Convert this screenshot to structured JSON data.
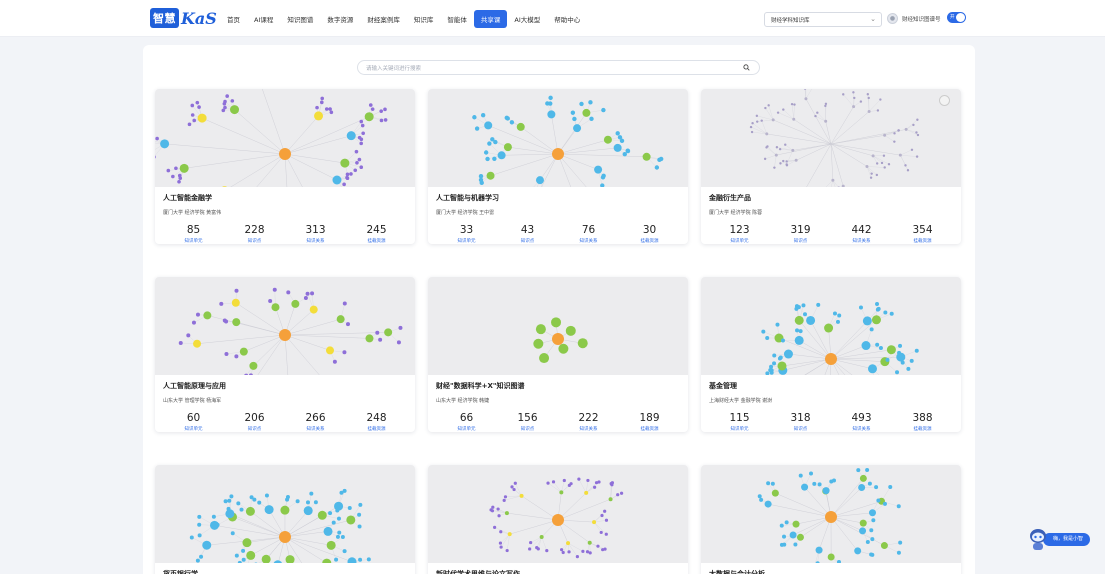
{
  "header": {
    "logo_badge": "智慧",
    "logo_text": "KaS",
    "nav": [
      "首页",
      "AI课程",
      "知识图谱",
      "数字资源",
      "财经案例库",
      "知识库",
      "智能体",
      "共享课",
      "AI大模型",
      "帮助中心"
    ],
    "active_nav": "共享课",
    "kb_select": "财经学科知识库",
    "user_name": "财经知识图谱号",
    "toggle_label": "开"
  },
  "search": {
    "placeholder": "请输入关键词进行搜索"
  },
  "stat_labels": [
    "知识单元",
    "知识点",
    "知识关系",
    "挂载资源"
  ],
  "cards": [
    {
      "title": "人工智能金融学",
      "authors": "厦门大学 经济学院 黄富伟",
      "stats": [
        "85",
        "228",
        "313",
        "245"
      ]
    },
    {
      "title": "人工智能与机器学习",
      "authors": "厦门大学 经济学院 王中雷",
      "stats": [
        "33",
        "43",
        "76",
        "30"
      ]
    },
    {
      "title": "金融衍生产品",
      "authors": "厦门大学 经济学院 陈蓉",
      "stats": [
        "123",
        "319",
        "442",
        "354"
      ]
    },
    {
      "title": "人工智能原理与应用",
      "authors": "山东大学 管理学院 杨海军",
      "stats": [
        "60",
        "206",
        "266",
        "248"
      ]
    },
    {
      "title": "财经\"数据科学+X\"知识图谱",
      "authors": "山东大学 经济学院 韩婕",
      "stats": [
        "66",
        "156",
        "222",
        "189"
      ]
    },
    {
      "title": "基金管理",
      "authors": "上海财经大学 金融学院 谢澍",
      "stats": [
        "115",
        "318",
        "493",
        "388"
      ]
    },
    {
      "title": "货币银行学",
      "authors": "",
      "stats": [
        "",
        "",
        "",
        ""
      ]
    },
    {
      "title": "新时代学术思维与论文写作",
      "authors": "",
      "stats": [
        "",
        "",
        "",
        ""
      ]
    },
    {
      "title": "大数据与会计分析",
      "authors": "",
      "stats": [
        "",
        "",
        "",
        ""
      ]
    }
  ],
  "assistant": {
    "label": "嗨，我是小智"
  },
  "colors": {
    "accent": "#2c6ae6",
    "center_node": "#f5a03a",
    "green_node": "#8bc94a",
    "blue_node": "#4fb8e8",
    "purple_node": "#8e6fd8",
    "yellow_node": "#f3dd3a"
  },
  "thumb_styles": [
    "cluster-purple",
    "radial-blue",
    "sparse-grey",
    "radial-yellow",
    "small-star",
    "cluster-blue",
    "cluster-blue-2",
    "ring-purple",
    "radial-cyan"
  ]
}
